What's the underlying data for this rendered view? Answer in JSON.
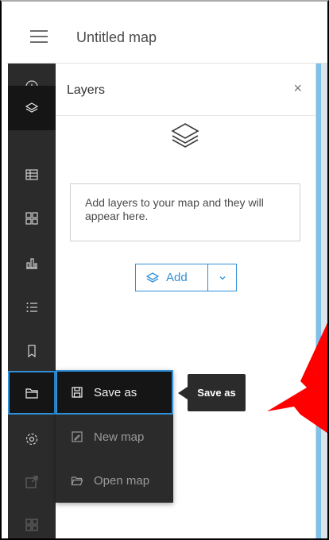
{
  "header": {
    "title": "Untitled map"
  },
  "toolbar": {
    "items": [
      {
        "icon": "plus-circle-icon"
      },
      {
        "icon": "layers-icon"
      },
      {
        "icon": "table-icon"
      },
      {
        "icon": "legend-icon"
      },
      {
        "icon": "chart-icon"
      },
      {
        "icon": "list-icon"
      },
      {
        "icon": "bookmark-icon"
      },
      {
        "icon": "folder-icon"
      },
      {
        "icon": "settings-icon"
      },
      {
        "icon": "share-icon"
      },
      {
        "icon": "grid-icon"
      }
    ]
  },
  "layers_panel": {
    "title": "Layers",
    "close_label": "×",
    "empty_message": "Add layers to your map and they will appear here.",
    "add_button": "Add"
  },
  "save_menu": {
    "items": [
      {
        "label": "Save as",
        "icon": "save-icon"
      },
      {
        "label": "New map",
        "icon": "new-map-icon"
      },
      {
        "label": "Open map",
        "icon": "open-folder-icon"
      }
    ]
  },
  "tooltip": {
    "text": "Save as"
  },
  "colors": {
    "accent": "#2f8fd8",
    "toolbar_bg": "#2b2b2b",
    "annotation": "#ff0000"
  }
}
